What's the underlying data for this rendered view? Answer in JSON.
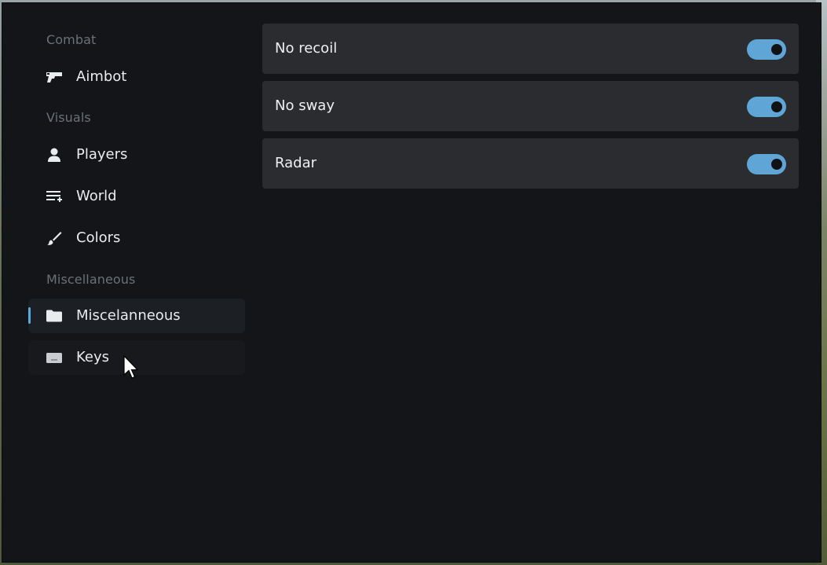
{
  "sidebar": {
    "sections": [
      {
        "title": "Combat",
        "items": [
          {
            "label": "Aimbot",
            "icon": "gun-icon"
          }
        ]
      },
      {
        "title": "Visuals",
        "items": [
          {
            "label": "Players",
            "icon": "person-icon"
          },
          {
            "label": "World",
            "icon": "list-add-icon"
          },
          {
            "label": "Colors",
            "icon": "brush-icon"
          }
        ]
      },
      {
        "title": "Miscellaneous",
        "items": [
          {
            "label": "Miscelanneous",
            "icon": "folder-icon",
            "active": true
          },
          {
            "label": "Keys",
            "icon": "keyboard-icon",
            "hover": true
          }
        ]
      }
    ]
  },
  "settings": [
    {
      "label": "No recoil",
      "enabled": true
    },
    {
      "label": "No sway",
      "enabled": true
    },
    {
      "label": "Radar",
      "enabled": true
    }
  ],
  "colors": {
    "accent": "#5fa6d6",
    "window_bg": "#141518",
    "row_bg": "#2a2c30"
  }
}
